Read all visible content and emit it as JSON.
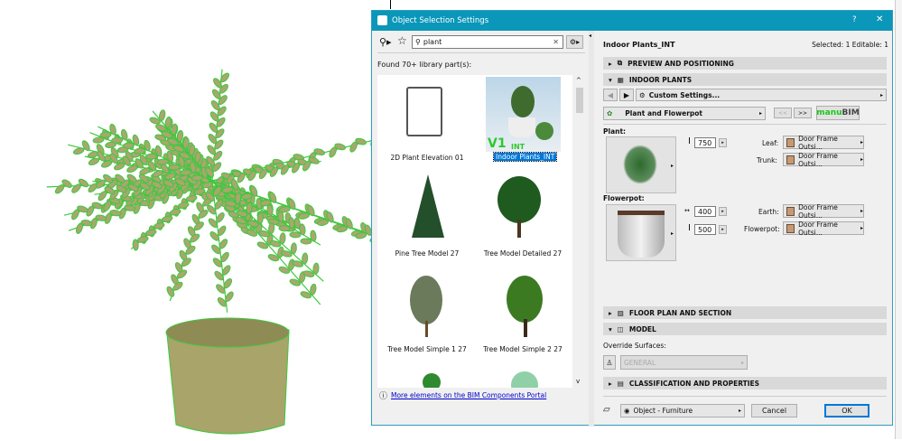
{
  "dialog": {
    "title": "Object Selection Settings",
    "help": "?",
    "close": "✕"
  },
  "library": {
    "search_value": "plant",
    "found": "Found 70+ library part(s):",
    "items": [
      {
        "label": "2D Plant Elevation 01",
        "selected": false
      },
      {
        "label": "Indoor Plants_INT",
        "selected": true,
        "badge": "V1",
        "badge_sub": "INT"
      },
      {
        "label": "Pine Tree Model 27",
        "selected": false
      },
      {
        "label": "Tree Model Detailed 27",
        "selected": false
      },
      {
        "label": "Tree Model Simple 1 27",
        "selected": false
      },
      {
        "label": "Tree Model Simple 2 27",
        "selected": false
      }
    ],
    "portal_link": "More elements on the BIM Components Portal"
  },
  "settings": {
    "name": "Indoor Plants_INT",
    "selected_info": "Selected: 1 Editable: 1",
    "sections": {
      "preview": "PREVIEW AND POSITIONING",
      "indoor": "INDOOR PLANTS",
      "floor": "FLOOR PLAN AND SECTION",
      "model": "MODEL",
      "classification": "CLASSIFICATION AND PROPERTIES"
    },
    "custom_settings": "Custom Settings...",
    "page": "Plant and Flowerpot",
    "prev": "<<",
    "next": ">>",
    "brand_a": "manu",
    "brand_b": "BIM",
    "plant_label": "Plant:",
    "plant_height": "750",
    "leaf_label": "Leaf:",
    "leaf_value": "Door Frame Outsi...",
    "trunk_label": "Trunk:",
    "trunk_value": "Door Frame Outsi...",
    "flowerpot_label": "Flowerpot:",
    "pot_width": "400",
    "pot_height": "500",
    "earth_label": "Earth:",
    "earth_value": "Door Frame Outsi...",
    "pot_label": "Flowerpot:",
    "pot_value": "Door Frame Outsi...",
    "override_label": "Override Surfaces:",
    "override_value": "GENERAL",
    "layer": "Object - Furniture",
    "cancel": "Cancel",
    "ok": "OK"
  },
  "colors": {
    "title": "#0a97b9",
    "plant": "#3ec83e",
    "pot": "#a8a46a"
  }
}
